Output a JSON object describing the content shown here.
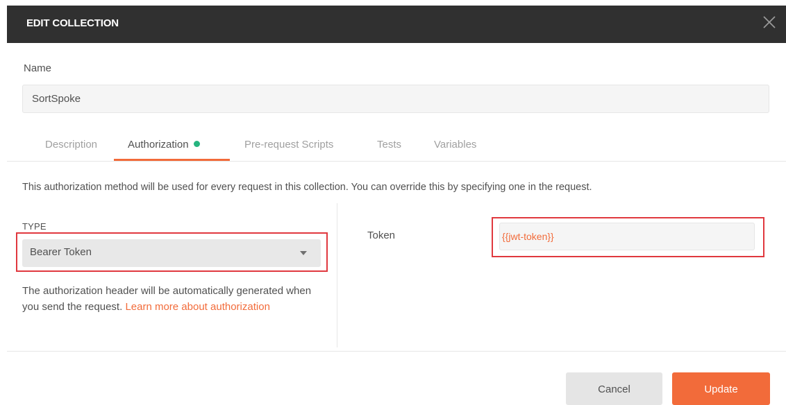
{
  "header": {
    "title": "EDIT COLLECTION",
    "close_icon": "close-icon"
  },
  "name": {
    "label": "Name",
    "value": "SortSpoke"
  },
  "tabs": [
    {
      "label": "Description",
      "active": false
    },
    {
      "label": "Authorization",
      "active": true,
      "status_dot_color": "#26b47f"
    },
    {
      "label": "Pre-request Scripts",
      "active": false
    },
    {
      "label": "Tests",
      "active": false
    },
    {
      "label": "Variables",
      "active": false
    }
  ],
  "authorization": {
    "description": "This authorization method will be used for every request in this collection. You can override this by specifying one in the request.",
    "type_label": "TYPE",
    "type_value": "Bearer Token",
    "help_text": "The authorization header will be automatically generated when you send the request.",
    "help_link": "Learn more about authorization",
    "token_label": "Token",
    "token_value": "{{jwt-token}}"
  },
  "footer": {
    "cancel_label": "Cancel",
    "update_label": "Update"
  },
  "colors": {
    "accent": "#f26b3a",
    "header_bg": "#303030",
    "highlight": "#e0383e",
    "status_green": "#26b47f"
  }
}
